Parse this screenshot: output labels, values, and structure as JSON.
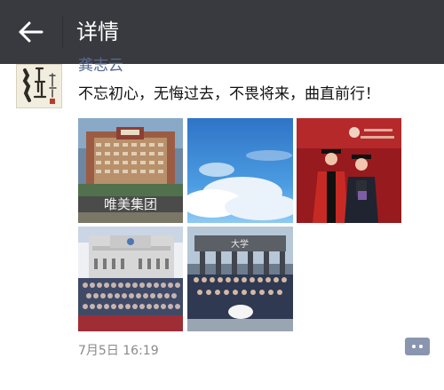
{
  "header": {
    "title": "详情",
    "back_icon": "arrow-left-icon"
  },
  "post": {
    "username": "龚志云",
    "text": "不忘初心，无悔过去，不畏将来，曲直前行！",
    "timestamp": "7月5日 16:19",
    "avatar_text": "志凌云",
    "photos": [
      {
        "caption": "唯美集团"
      },
      {
        "caption": ""
      },
      {
        "caption": ""
      },
      {
        "caption": ""
      },
      {
        "caption": "大学"
      }
    ]
  },
  "actions": {
    "comment_icon": "comment-more-icon"
  },
  "colors": {
    "header_bg": "#393a3f",
    "username": "#576b95",
    "timestamp": "#8a8a8a",
    "comment_button": "#8a96b0"
  }
}
